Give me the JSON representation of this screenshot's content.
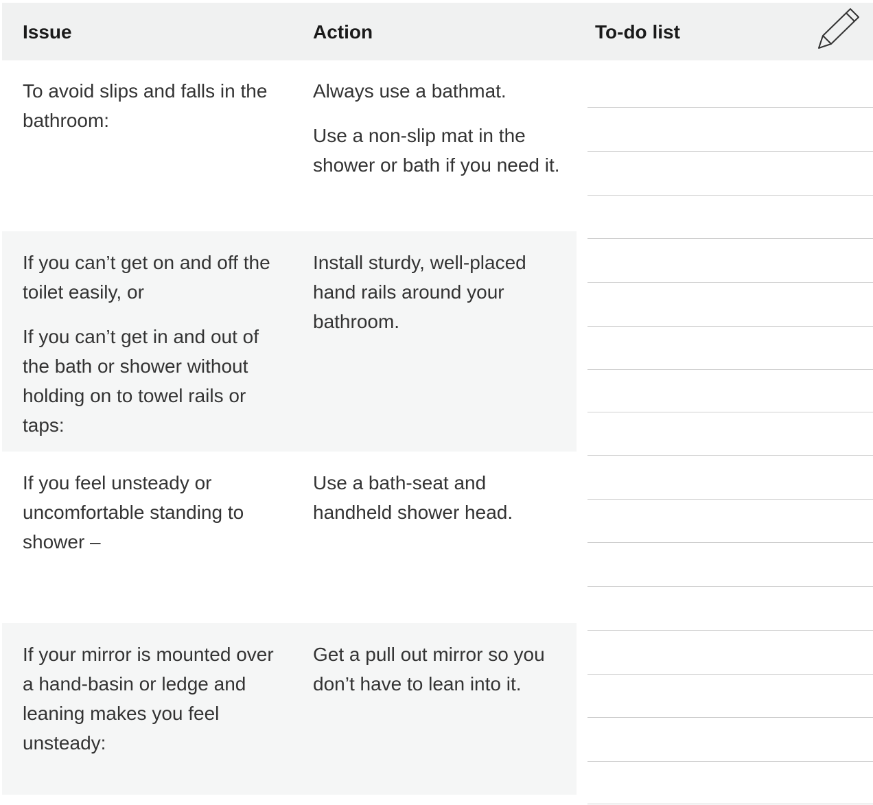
{
  "header": {
    "issue": "Issue",
    "action": "Action",
    "todo": "To-do list"
  },
  "rows": [
    {
      "issue": [
        "To avoid slips and falls in the bathroom:"
      ],
      "action": [
        "Always use a bathmat.",
        "Use a non-slip mat in the shower or bath if you need it."
      ]
    },
    {
      "issue": [
        "If you can’t get on and off the toilet easily, or",
        "If you can’t get in and out of the bath or shower without holding on to towel rails or taps:"
      ],
      "action": [
        "Install sturdy, well-placed hand rails around your bathroom."
      ]
    },
    {
      "issue": [
        "If you feel unsteady or uncomfortable standing to shower –"
      ],
      "action": [
        "Use a bath-seat and handheld shower head."
      ]
    },
    {
      "issue": [
        "If your mirror is mounted over a hand-basin or ledge and leaning makes you feel unsteady:"
      ],
      "action": [
        "Get a pull out mirror so you don’t have to lean into it."
      ]
    }
  ],
  "icons": {
    "header": "pencil-icon"
  },
  "colors": {
    "header_bg": "#f0f1f1",
    "row_shade": "#f5f6f6",
    "line": "#cfcfcf"
  }
}
